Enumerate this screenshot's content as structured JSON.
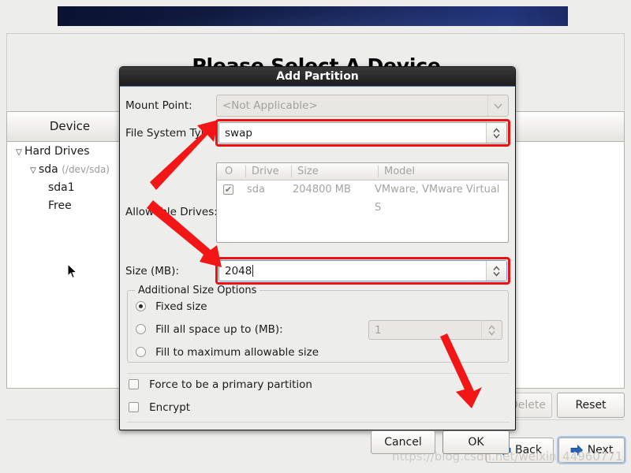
{
  "installer": {
    "page_title": "Please Select A Device",
    "device_column_header": "Device",
    "tree": [
      {
        "label": "Hard Drives",
        "detail": "",
        "level": 0,
        "twisty": "▽"
      },
      {
        "label": "sda",
        "detail": "(/dev/sda)",
        "level": 1,
        "twisty": "▽"
      },
      {
        "label": "sda1",
        "detail": "",
        "level": 2,
        "twisty": ""
      },
      {
        "label": "Free",
        "detail": "",
        "level": 2,
        "twisty": ""
      }
    ],
    "buttons": {
      "delete": "Delete",
      "reset": "Reset",
      "back": "Back",
      "next": "Next"
    },
    "watermark": "https://blog.csdn.net/weixin_44960771"
  },
  "dialog": {
    "title": "Add Partition",
    "mount_point": {
      "label": "Mount Point:",
      "value": "<Not Applicable>",
      "enabled": false,
      "icon": "chevron-down-icon"
    },
    "file_system_type": {
      "label": "File System Type:",
      "value": "swap",
      "highlighted": true,
      "icon": "spinner-updown-icon"
    },
    "allowable_drives": {
      "label": "Allowable Drives:",
      "columns": [
        "O",
        "Drive",
        "Size",
        "Model"
      ],
      "rows": [
        {
          "checked": true,
          "drive": "sda",
          "size": "204800 MB",
          "model": "VMware, VMware Virtual S"
        }
      ]
    },
    "size": {
      "label": "Size (MB):",
      "value": "2048",
      "highlighted": true,
      "focused": true,
      "icon": "spinner-updown-icon"
    },
    "additional_size_options": {
      "legend": "Additional Size Options",
      "options": [
        {
          "label": "Fixed size",
          "selected": true
        },
        {
          "label": "Fill all space up to (MB):",
          "selected": false
        },
        {
          "label": "Fill to maximum allowable size",
          "selected": false
        }
      ],
      "fill_up_to_value": "1",
      "fill_up_to_enabled": false
    },
    "checkboxes": [
      {
        "label": "Force to be a primary partition",
        "checked": false
      },
      {
        "label": "Encrypt",
        "checked": false
      }
    ],
    "buttons": {
      "cancel": "Cancel",
      "ok": "OK"
    }
  },
  "annotations": {
    "color": "#ee1111",
    "arrows": [
      {
        "name": "arrow-to-file-system-type"
      },
      {
        "name": "arrow-to-size-field"
      },
      {
        "name": "arrow-to-ok-button"
      }
    ]
  }
}
